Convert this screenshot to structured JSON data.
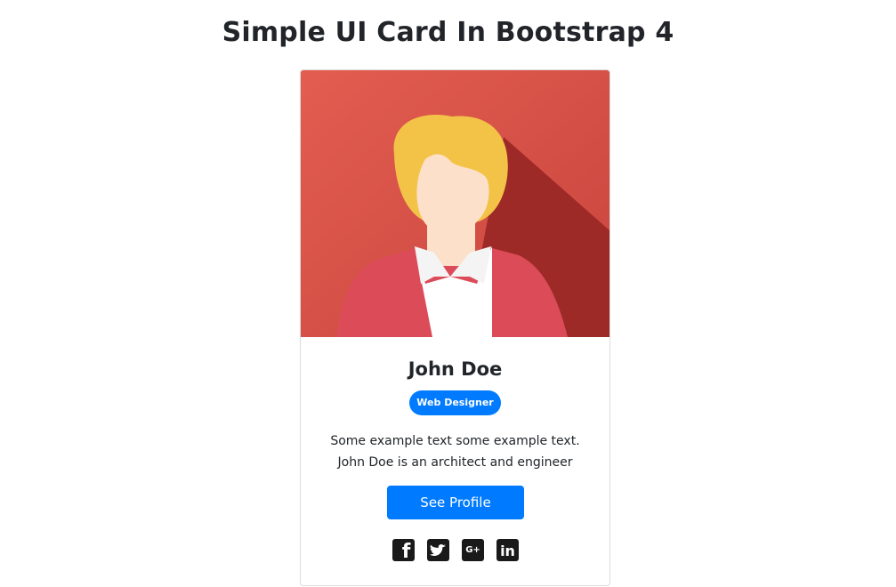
{
  "page": {
    "title": "Simple UI Card In Bootstrap 4"
  },
  "card": {
    "name": "John Doe",
    "role_badge": "Web Designer",
    "description_line1": "Some example text some example text.",
    "description_line2": "John Doe is an architect and engineer",
    "button_label": "See Profile",
    "avatar_icon": "female-avatar-illustration",
    "social_links": [
      {
        "name": "facebook",
        "icon": "facebook-icon",
        "glyph": "f"
      },
      {
        "name": "twitter",
        "icon": "twitter-icon",
        "glyph": ""
      },
      {
        "name": "google-plus",
        "icon": "google-plus-icon",
        "glyph": "G+"
      },
      {
        "name": "linkedin",
        "icon": "linkedin-icon",
        "glyph": "in"
      }
    ]
  },
  "colors": {
    "accent": "#007bff",
    "avatar_background": "#e0574b",
    "avatar_shadow": "#9e2a28",
    "hair": "#f2c347",
    "skin": "#fde0c9",
    "jacket": "#dc4b58",
    "shirt": "#ffffff",
    "social_icon": "#1a1a1a"
  }
}
